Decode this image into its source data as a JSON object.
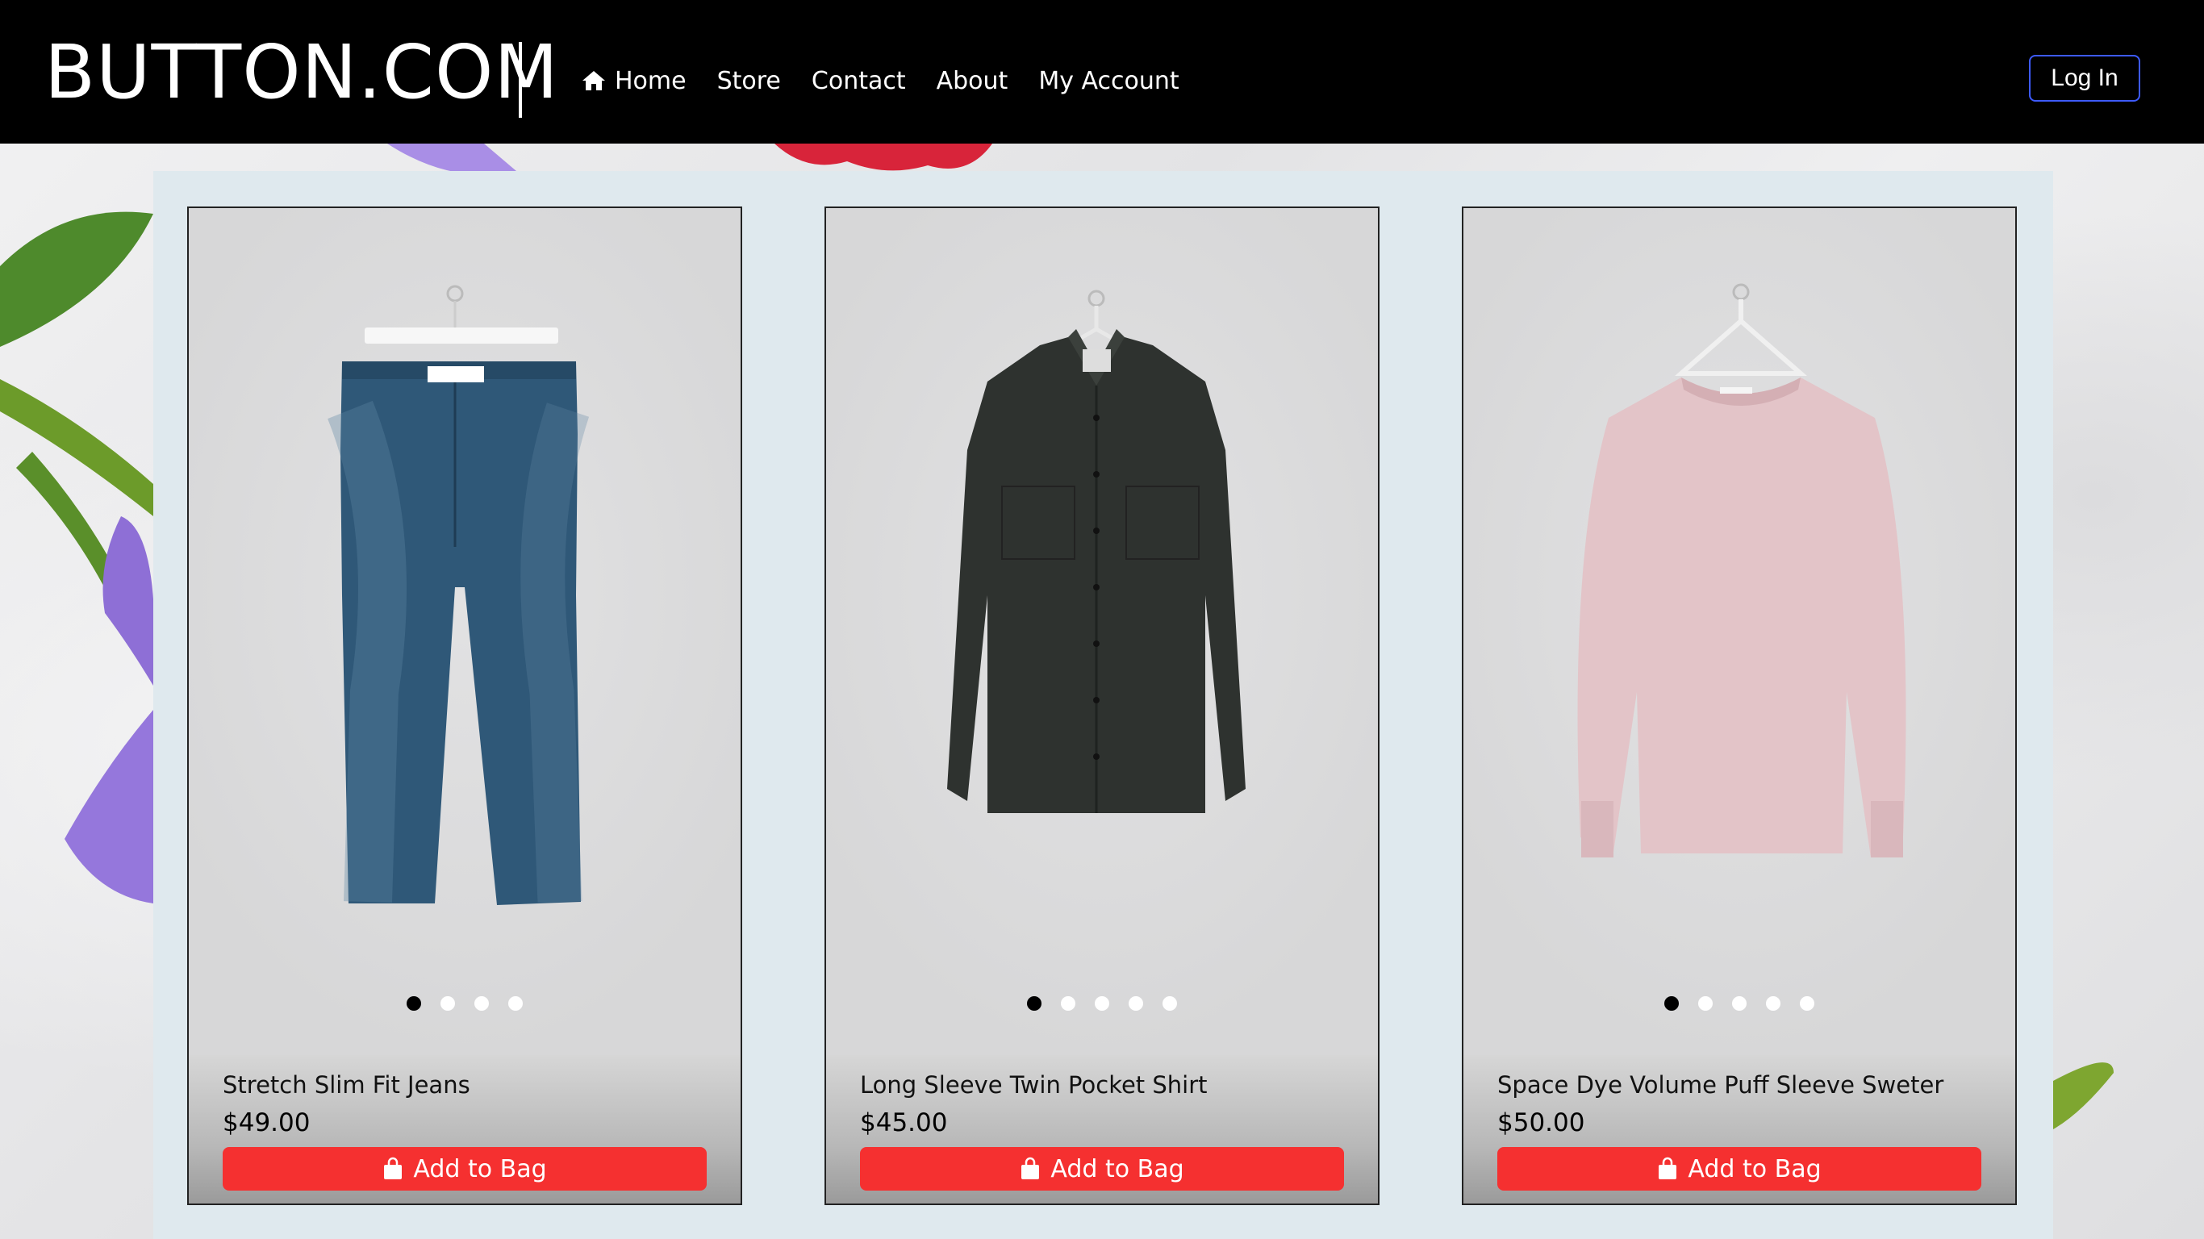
{
  "brand": {
    "name": "BUTTON.COM"
  },
  "nav": {
    "items": [
      {
        "label": "Home",
        "icon": "home-icon"
      },
      {
        "label": "Store"
      },
      {
        "label": "Contact"
      },
      {
        "label": "About"
      },
      {
        "label": "My Account"
      }
    ],
    "login_label": "Log In"
  },
  "products": [
    {
      "name": "Stretch Slim Fit Jeans",
      "price": "$49.00",
      "button": "Add to Bag",
      "image": "jeans",
      "dots": 4,
      "active_dot": 0
    },
    {
      "name": "Long Sleeve Twin Pocket Shirt",
      "price": "$45.00",
      "button": "Add to Bag",
      "image": "shirt",
      "dots": 5,
      "active_dot": 0
    },
    {
      "name": "Space Dye Volume Puff Sleeve Sweter",
      "price": "$50.00",
      "button": "Add to Bag",
      "image": "sweater",
      "dots": 5,
      "active_dot": 0
    }
  ],
  "colors": {
    "navbar": "#000000",
    "panel": "#dfe9ee",
    "add_button": "#f53030",
    "login_border": "#3d5afe"
  }
}
